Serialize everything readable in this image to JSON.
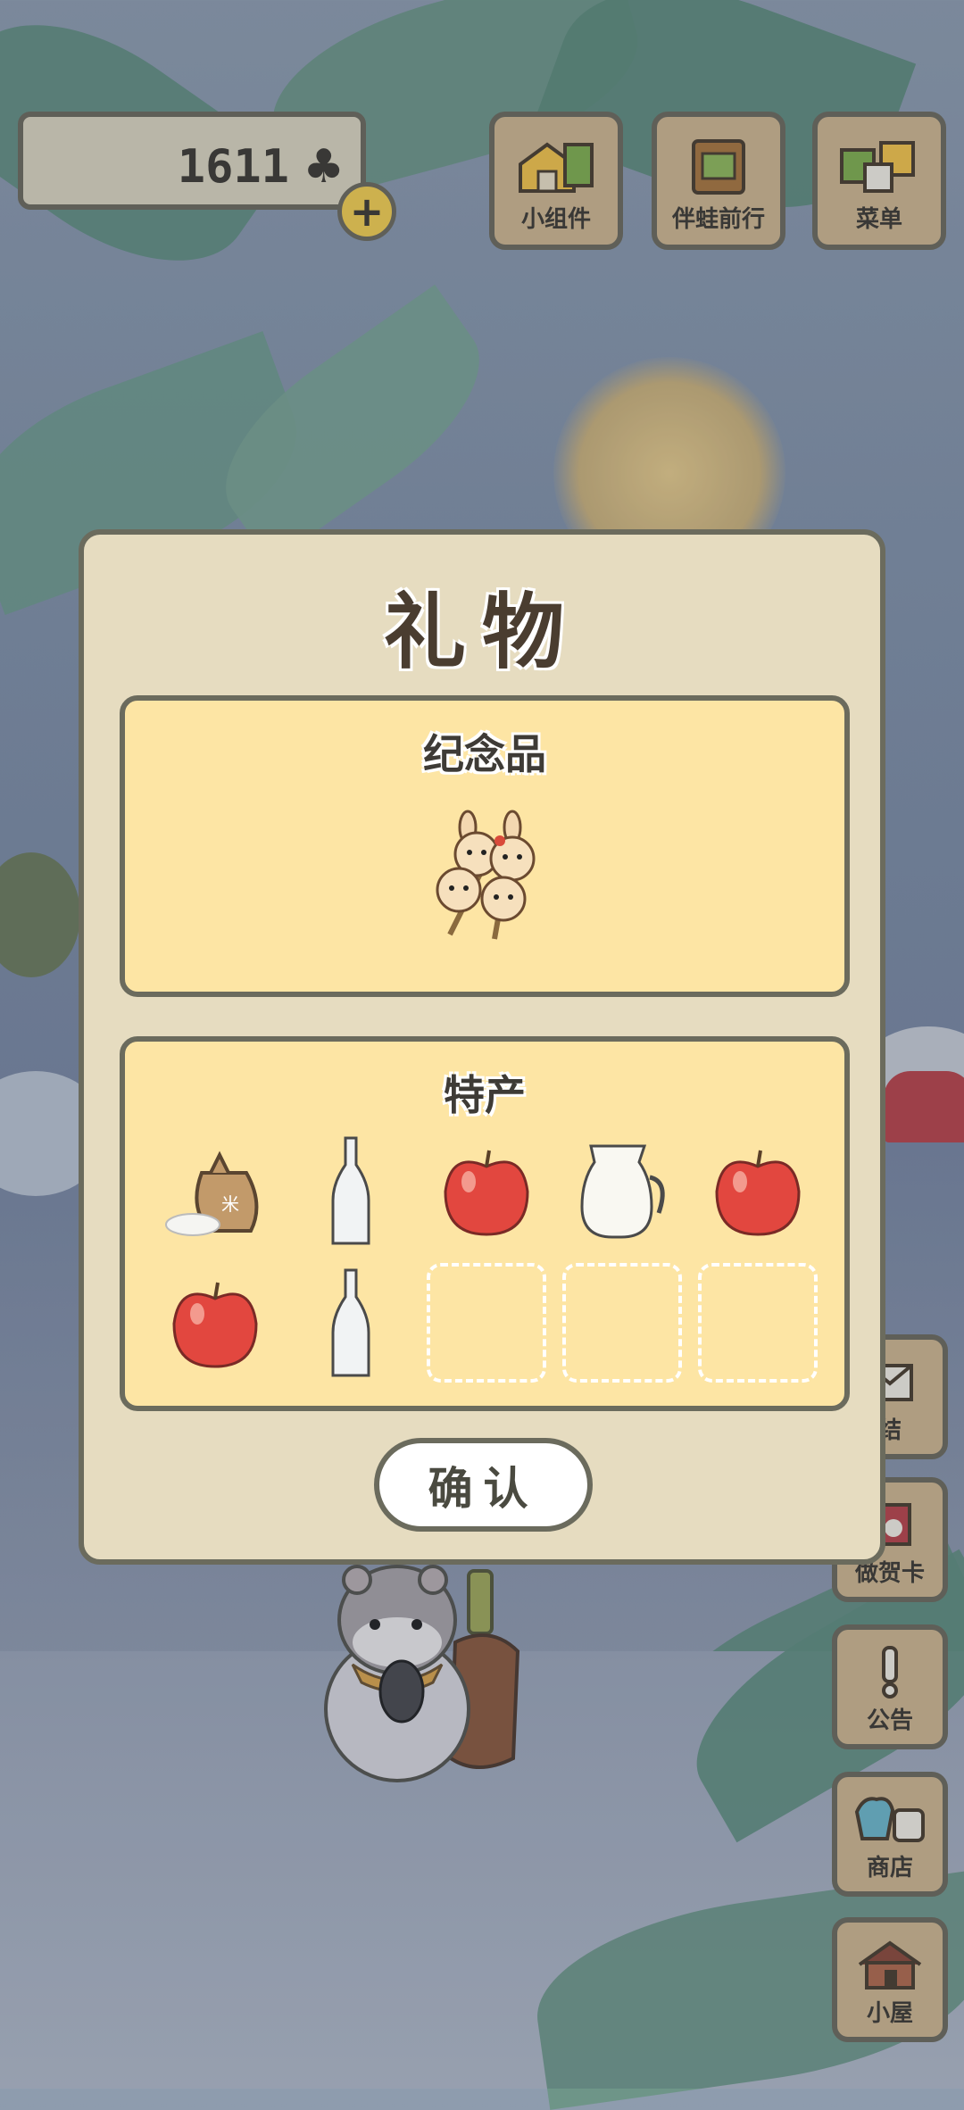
{
  "hud": {
    "clover_count": "1611",
    "clover_symbol": "♣",
    "plus_symbol": "+"
  },
  "top_buttons": [
    {
      "label": "小组件",
      "icon": "widget-icon"
    },
    {
      "label": "伴蛙前行",
      "icon": "journal-icon"
    },
    {
      "label": "菜单",
      "icon": "menu-cards-icon"
    }
  ],
  "side_buttons": [
    {
      "label": "结",
      "icon": "letter-icon"
    },
    {
      "label": "做贺卡",
      "icon": "greeting-card-icon"
    },
    {
      "label": "公告",
      "icon": "notice-icon"
    },
    {
      "label": "商店",
      "icon": "shop-icon"
    },
    {
      "label": "小屋",
      "icon": "house-icon"
    }
  ],
  "dialog": {
    "title": "礼物",
    "souvenir": {
      "title": "纪念品",
      "item_icon": "bunny-skewer-icon"
    },
    "specialties": {
      "title": "特产",
      "items": [
        "rice-sack-icon",
        "glass-bottle-icon",
        "apple-icon",
        "milk-jug-icon",
        "apple-icon",
        "apple-icon",
        "glass-bottle-icon",
        "empty",
        "empty",
        "empty"
      ],
      "rice_label": "米"
    },
    "confirm_label": "确认"
  }
}
